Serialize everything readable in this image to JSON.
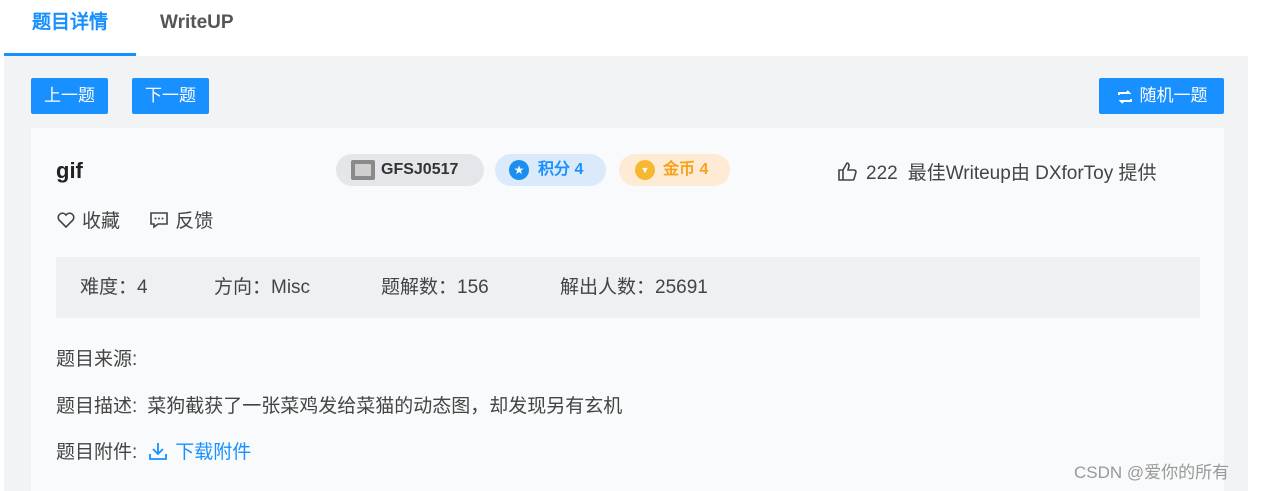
{
  "tabs": {
    "detail": "题目详情",
    "writeup": "WriteUP"
  },
  "nav": {
    "prev": "上一题",
    "next": "下一题",
    "random": "随机一题"
  },
  "challenge": {
    "name": "gif",
    "id": "GFSJ0517",
    "score_label": "积分 4",
    "coin_label": "金币 4",
    "likes": "222",
    "best_writeup": "最佳Writeup由 DXforToy 提供"
  },
  "actions": {
    "favorite": "收藏",
    "feedback": "反馈"
  },
  "stats": {
    "difficulty": "难度：4",
    "direction": "方向：Misc",
    "solves": "题解数：156",
    "solvers": "解出人数：25691"
  },
  "info": {
    "source_label": "题目来源:",
    "desc_label": "题目描述:",
    "desc": "菜狗截获了一张菜鸡发给菜猫的动态图，却发现另有玄机",
    "attach_label": "题目附件:",
    "attach_link": "下载附件"
  },
  "watermark": "CSDN @爱你的所有",
  "colors": {
    "accent": "#1890ff",
    "coin": "#f6a21a",
    "panel": "#f2f3f5"
  }
}
